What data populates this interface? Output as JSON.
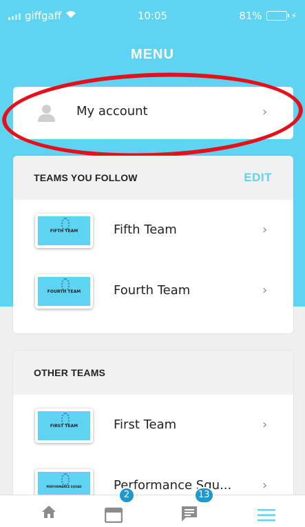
{
  "status_bar": {
    "carrier": "giffgaff",
    "time": "10:05",
    "battery": "81%",
    "battery_level": 0.81,
    "wifi_icon": "wifi-icon",
    "charging_icon": "bolt-icon"
  },
  "header": {
    "title": "MENU"
  },
  "account": {
    "label": "My account",
    "icon": "person-icon"
  },
  "teams_you_follow": {
    "title": "TEAMS YOU FOLLOW",
    "edit_label": "EDIT",
    "items": [
      {
        "name": "Fifth Team",
        "thumb_label": "FIFTH TEAM"
      },
      {
        "name": "Fourth Team",
        "thumb_label": "FOURTH TEAM"
      }
    ]
  },
  "other_teams": {
    "title": "OTHER TEAMS",
    "items": [
      {
        "name": "First Team",
        "thumb_label": "FIRST TEAM"
      },
      {
        "name": "Performance Squ...",
        "thumb_label": "PERFORMANCE SQUAD"
      }
    ]
  },
  "tab_bar": {
    "home_icon": "home-icon",
    "calendar_icon": "calendar-icon",
    "calendar_badge": "2",
    "messages_icon": "chat-icon",
    "messages_badge": "13",
    "menu_icon": "hamburger-icon"
  },
  "colors": {
    "brand": "#5fd3f2",
    "highlight": "#e6101b",
    "badge": "#1d98d0",
    "battery_fill": "#33e23d"
  }
}
